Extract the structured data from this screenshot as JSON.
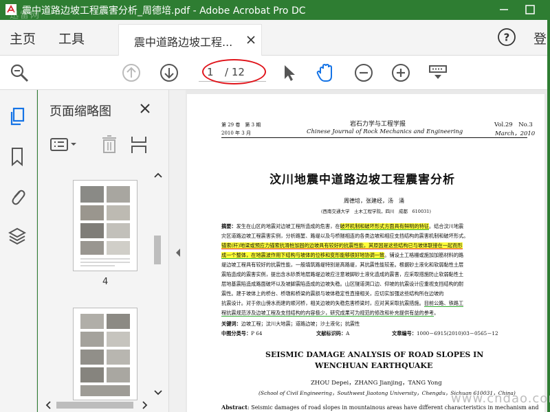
{
  "window": {
    "title": "震中道路边坡工程震害分析_周德培.pdf - Adobe Acrobat Pro DC",
    "watermark": "迅雷网"
  },
  "menu": {
    "home": "主页",
    "tools": "工具",
    "tab_label": "震中道路边坡工程...",
    "signin": "登"
  },
  "toolbar": {
    "page_current": "1",
    "page_total": "/ 12"
  },
  "thumbnails": {
    "title": "页面缩略图",
    "items": [
      {
        "label": "4"
      },
      {
        "label": ""
      }
    ]
  },
  "doc": {
    "header_left_1": "第 29 卷　第 3 期",
    "header_left_2": "2010 年 3 月",
    "journal_cn": "岩石力学与工程学报",
    "journal_en": "Chinese Journal of Rock Mechanics and Engineering",
    "header_right_1": "Vol.29　No.3",
    "header_right_2": "March，2010",
    "title_cn": "汶川地震中道路边坡工程震害分析",
    "authors_cn": "周德培，张建经，汤　涌",
    "affil_cn": "(西南交通大学　土木工程学院，四川　成都　610031)",
    "abstract_lines": [
      {
        "lead": "摘要：",
        "pre": "发生在山区的地震对边坡工程所造成的危害，在",
        "hl": "破坏机制和破坏形式方面具有鲜明的特征",
        "post": "。结合汶川地震"
      },
      {
        "pre": "灾区道路边坡工程震害实例，分析路堑、路堤以及与桥隧相连的各类边坡和相应支挡结构的震害机制和破坏形式。"
      },
      {
        "hl": "锚索(杆)地梁或预应力锚索抗滑桩加固的边坡具有较好的抗震性能，其原因是这些结构已与坡体联接在一起而形",
        "style": "yellow-red"
      },
      {
        "hl": "成一个整体，在地震波作用下结构与坡体的位移和变形能够很好地协调一致",
        "post": "。铺设土工格栅或施加加筋材料的路",
        "style": "yellow-green"
      },
      {
        "pre": "堤边坡工程具有较好的抗震性能，一般填筑路堤特别是高路堤，其抗震性能较差。根据砂土液化和软弱黏性土层"
      },
      {
        "pre": "震陷造成的震害实例，提出含水砂质地层路堤边坡应注意坡脚砂土液化造成的震害，应采取措施防止软弱黏性土"
      },
      {
        "pre": "层地基震陷造成路面破坏以及坡脚震陷造成的边坡失稳。山区隧道洞口边、仰坡的抗震设计应重视支挡结构的耐"
      },
      {
        "pre": "震性。建于坡体上的桥台、桥墩和桥梁的震损与坡体稳定性直接相关，应切实加强这些结构所在边坡的"
      },
      {
        "pre": "抗震设计。对于依山傍水而建的顺河桥，相关边坡的失稳危害桥梁时，应对其采取抗震措施。",
        "ul": "目前公路、铁路工",
        "style": "green-ul"
      },
      {
        "ul": "程抗震规范涉及边坡工程及支挡结构的内容极少，研究成果可为规范的修改和补充提供有益的参考",
        "post": "。",
        "style": "green-ul"
      }
    ],
    "keywords_label": "关键词：",
    "keywords": "边坡工程；汶川大地震；道路边坡；沙土液化；抗震性",
    "class_label": "中图分类号：",
    "class_value": "P 64",
    "doc_code_label": "文献标识码：",
    "doc_code_value": "A",
    "article_no_label": "文章编号：",
    "article_no_value": "1000－6915(2010)03－0565－12",
    "title_en_1": "SEISMIC DAMAGE ANALYSIS OF ROAD SLOPES IN",
    "title_en_2": "WENCHUAN EARTHQUAKE",
    "authors_en": "ZHOU Depei，ZHANG Jianjing，TANG Yong",
    "affil_en": "(School of Civil Engineering，Southwest Jiaotong University，Chengdu，Sichuan 610031，China)",
    "abstract_en_label": "Abstract",
    "abstract_en": ": Seismic damages of road slopes in mountainous areas have different characteristics in mechanism and"
  },
  "site_watermark": "www.cndao.com"
}
